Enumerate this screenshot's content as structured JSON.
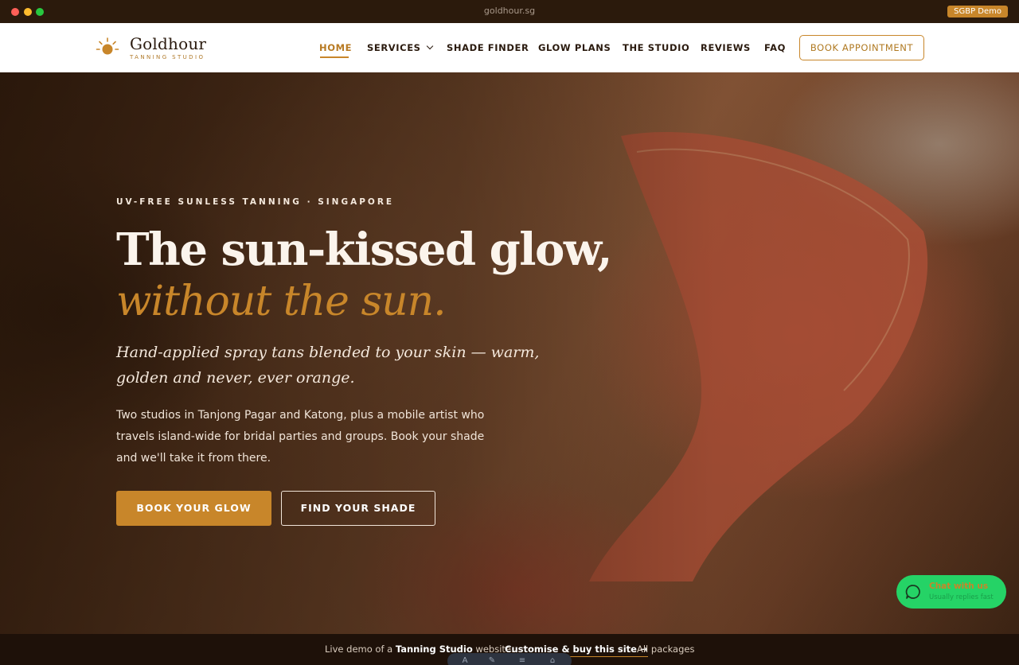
{
  "browser": {
    "url": "goldhour.sg",
    "badge": "SGBP Demo"
  },
  "header": {
    "logo_name": "Goldhour",
    "logo_sub": "TANNING STUDIO",
    "nav": [
      {
        "label": "HOME",
        "active": true
      },
      {
        "label": "SERVICES"
      },
      {
        "label": "SHADE FINDER"
      },
      {
        "label": "GLOW PLANS"
      },
      {
        "label": "THE STUDIO"
      },
      {
        "label": "REVIEWS"
      },
      {
        "label": "FAQ"
      }
    ],
    "book_label": "BOOK APPOINTMENT"
  },
  "hero": {
    "eyebrow": "UV-FREE SUNLESS TANNING · SINGAPORE",
    "headline_line1": "The sun-kissed glow,",
    "headline_line2": "without the sun.",
    "tagline": "Hand-applied spray tans blended to your skin — warm, golden and never, ever orange.",
    "body": "Two studios in Tanjong Pagar and Katong, plus a mobile artist who travels island-wide for bridal parties and groups. Book your shade and we'll take it from there.",
    "primary_cta": "BOOK YOUR GLOW",
    "secondary_cta": "FIND YOUR SHADE"
  },
  "chat": {
    "title": "Chat with us",
    "subtitle": "Usually replies fast"
  },
  "bottom_bar": {
    "prefix": "Live demo of a ",
    "site_type": "Tanning Studio",
    "suffix": " website.",
    "customise": "Customise & buy this site →",
    "packages": "All packages"
  },
  "colors": {
    "accent": "#c8862a",
    "dark": "#2a1a0e",
    "chat_green": "#25d366"
  }
}
